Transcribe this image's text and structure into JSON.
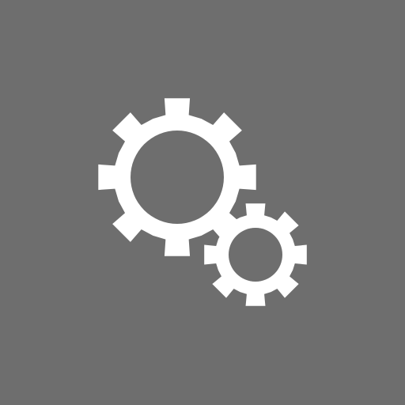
{
  "icon": {
    "name": "gears-icon",
    "background_color": "#6e6e6e",
    "foreground_color": "#ffffff",
    "parts": [
      "large-gear",
      "small-gear"
    ]
  }
}
